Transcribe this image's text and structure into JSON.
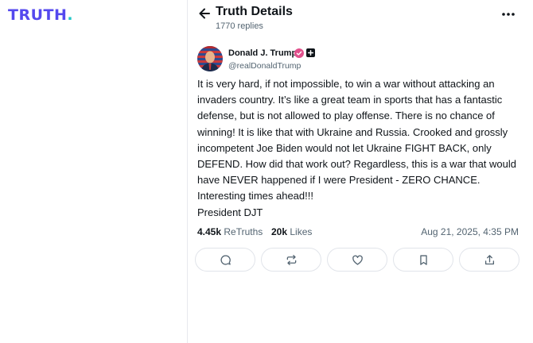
{
  "brand": {
    "logo_text": "TRUTH",
    "logo_dot": ".",
    "primary_color": "#5448ee",
    "accent_color": "#22c7c7"
  },
  "header": {
    "title": "Truth Details",
    "replies": "1770 replies",
    "back_icon": "arrow-left-icon",
    "more_icon": "more-horizontal-icon"
  },
  "author": {
    "name": "Donald J. Trump",
    "handle": "@realDonaldTrump",
    "verified_icon": "verified-badge-icon",
    "plus_icon": "plus-badge-icon"
  },
  "post": {
    "text": "It is very hard, if not impossible, to win a war without attacking an invaders country. It’s like a great team in sports that has a fantastic defense, but is not allowed to play offense. There is no chance of winning! It is like that with Ukraine and Russia. Crooked and grossly incompetent Joe Biden would not let Ukraine FIGHT BACK, only DEFEND. How did that work out? Regardless, this is a war that would have NEVER happened if I were President - ZERO CHANCE. Interesting times ahead!!!\nPresident DJT",
    "retruths_count": "4.45k",
    "retruths_label": "ReTruths",
    "likes_count": "20k",
    "likes_label": "Likes",
    "timestamp": "Aug 21, 2025, 4:35 PM"
  },
  "actions": [
    {
      "name": "reply-button",
      "icon": "comment-icon"
    },
    {
      "name": "retruth-button",
      "icon": "repost-icon"
    },
    {
      "name": "like-button",
      "icon": "heart-icon"
    },
    {
      "name": "bookmark-button",
      "icon": "bookmark-icon"
    },
    {
      "name": "share-button",
      "icon": "share-icon"
    }
  ]
}
